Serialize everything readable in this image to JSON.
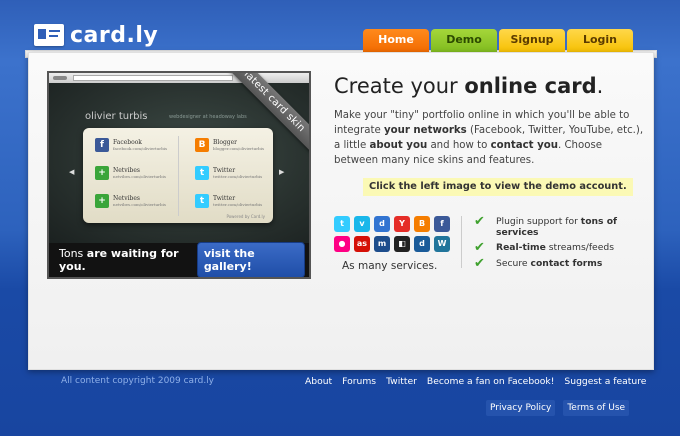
{
  "brand": {
    "name": "card.ly"
  },
  "nav": {
    "tabs": [
      {
        "label": "Home"
      },
      {
        "label": "Demo"
      },
      {
        "label": "Signup"
      },
      {
        "label": "Login"
      }
    ]
  },
  "preview": {
    "ribbon": "latest card skin",
    "profile_name": "olivier turbis",
    "profile_subtitle": "webdesigner at headoway labs",
    "networks": [
      {
        "name": "Facebook",
        "url": "facebook.com/olivierturbis",
        "color": "#3b5998",
        "icon": "facebook-icon"
      },
      {
        "name": "Blogger",
        "url": "blogger.com/olivierturbis",
        "color": "#f57d00",
        "icon": "blogger-icon"
      },
      {
        "name": "Netvibes",
        "url": "netvibes.com/olivierturbis",
        "color": "#3aa53a",
        "icon": "netvibes-icon"
      },
      {
        "name": "Twitter",
        "url": "twitter.com/olivierturbis",
        "color": "#33ccff",
        "icon": "twitter-icon"
      },
      {
        "name": "Netvibes",
        "url": "netvibes.com/olivierturbis",
        "color": "#3aa53a",
        "icon": "netvibes-icon"
      },
      {
        "name": "Twitter",
        "url": "twitter.com/olivierturbis",
        "color": "#33ccff",
        "icon": "twitter-icon"
      }
    ],
    "powered": "Powered by Card.ly",
    "tagline_pre": "Tons ",
    "tagline_bold": "are waiting for you.",
    "gallery_button": "visit the gallery!"
  },
  "hero": {
    "headline_pre": "Create your ",
    "headline_bold": "online card",
    "headline_post": ".",
    "desc_1": "Make your \"tiny\" portfolio online in which you'll be able to integrate ",
    "desc_b1": "your networks",
    "desc_2": " (Facebook, Twitter, YouTube, etc.), a little ",
    "desc_b2": "about you",
    "desc_3": " and how to ",
    "desc_b3": "contact you",
    "desc_4": ". Choose between many nice skins and features.",
    "hint": "Click the left image to view the demo account."
  },
  "services": {
    "icons": [
      {
        "icon": "twitter-icon",
        "color": "#33ccff",
        "glyph": "t"
      },
      {
        "icon": "vimeo-icon",
        "color": "#1ab7ea",
        "glyph": "v"
      },
      {
        "icon": "delicious-icon",
        "color": "#3274d1",
        "glyph": "d"
      },
      {
        "icon": "youtube-icon",
        "color": "#e52d27",
        "glyph": "Y"
      },
      {
        "icon": "blogger-icon",
        "color": "#f57d00",
        "glyph": "B"
      },
      {
        "icon": "facebook-icon",
        "color": "#3b5998",
        "glyph": "f"
      },
      {
        "icon": "flickr-icon",
        "color": "#ff0084",
        "glyph": "●"
      },
      {
        "icon": "lastfm-icon",
        "color": "#d51007",
        "glyph": "as"
      },
      {
        "icon": "myspace-icon",
        "color": "#1d4d8c",
        "glyph": "m"
      },
      {
        "icon": "delicious-icon",
        "color": "#222222",
        "glyph": "◧"
      },
      {
        "icon": "digg-icon",
        "color": "#1a5b99",
        "glyph": "d"
      },
      {
        "icon": "wordpress-icon",
        "color": "#21759b",
        "glyph": "W"
      }
    ],
    "caption": "As many services."
  },
  "features": [
    {
      "pre": "Plugin support for ",
      "bold": "tons of services",
      "post": ""
    },
    {
      "pre": "",
      "bold": "Real-time",
      "post": " streams/feeds"
    },
    {
      "pre": "Secure ",
      "bold": "contact forms",
      "post": ""
    }
  ],
  "footer": {
    "copyright": "All content copyright 2009 card.ly",
    "links": [
      "About",
      "Forums",
      "Twitter",
      "Become a fan on Facebook!",
      "Suggest a feature"
    ],
    "legal": [
      "Privacy Policy",
      "Terms of Use"
    ]
  }
}
